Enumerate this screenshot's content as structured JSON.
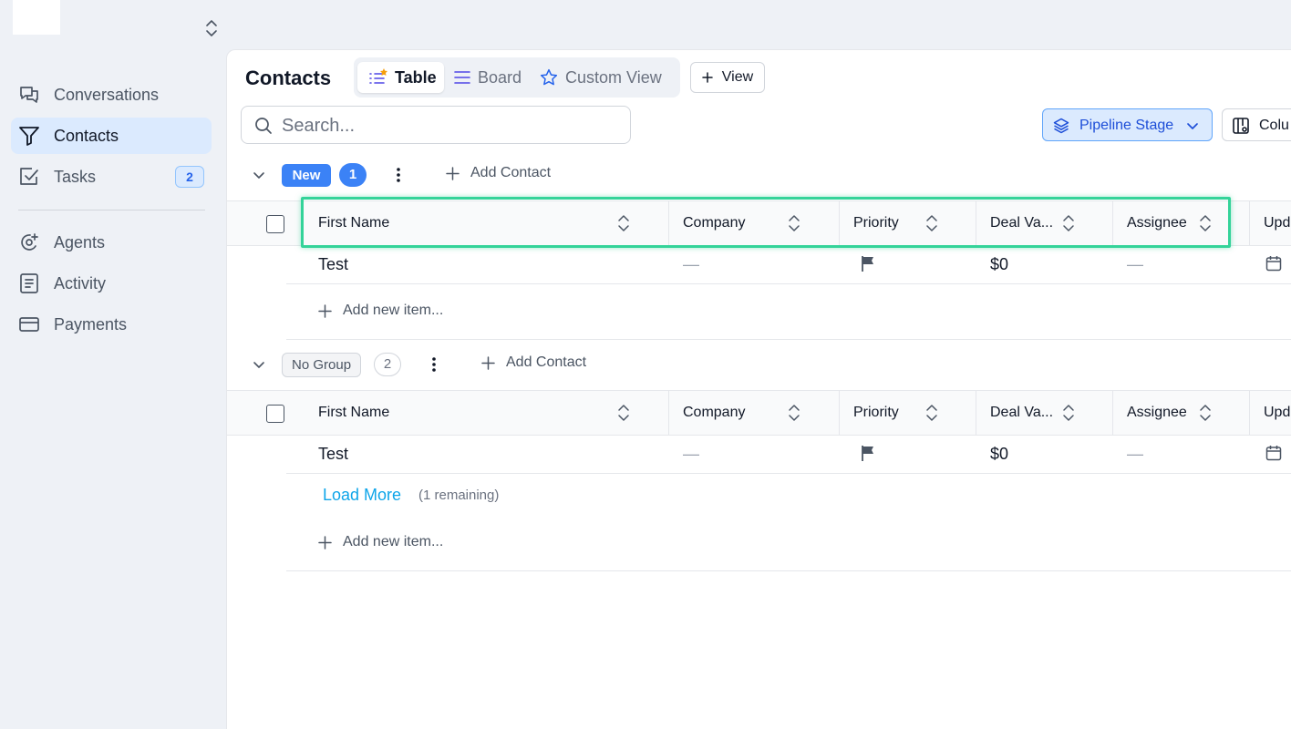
{
  "sidebar": {
    "items": [
      {
        "label": "Conversations"
      },
      {
        "label": "Contacts"
      },
      {
        "label": "Tasks",
        "badge": "2"
      },
      {
        "label": "Agents"
      },
      {
        "label": "Activity"
      },
      {
        "label": "Payments"
      }
    ]
  },
  "header": {
    "title": "Contacts",
    "tabs": [
      {
        "label": "Table"
      },
      {
        "label": "Board"
      },
      {
        "label": "Custom View"
      }
    ],
    "add_view_label": "View"
  },
  "toolbar": {
    "search_placeholder": "Search...",
    "pipeline_label": "Pipeline Stage",
    "columns_label": "Colu"
  },
  "columns": [
    "First Name",
    "Company",
    "Priority",
    "Deal Va...",
    "Assignee",
    "Upd"
  ],
  "groups": [
    {
      "name": "New",
      "count": "1",
      "add_contact_label": "Add Contact",
      "rows": [
        {
          "first_name": "Test",
          "company": "—",
          "deal_value": "$0",
          "assignee": "—"
        }
      ],
      "add_item_label": "Add new item..."
    },
    {
      "name": "No Group",
      "count": "2",
      "add_contact_label": "Add Contact",
      "rows": [
        {
          "first_name": "Test",
          "company": "—",
          "deal_value": "$0",
          "assignee": "—"
        }
      ],
      "load_more_label": "Load More",
      "remaining_label": "(1 remaining)",
      "add_item_label": "Add new item..."
    }
  ],
  "colors": {
    "accent": "#3b82f6",
    "highlight": "#34d399",
    "link": "#0ea5e9"
  }
}
